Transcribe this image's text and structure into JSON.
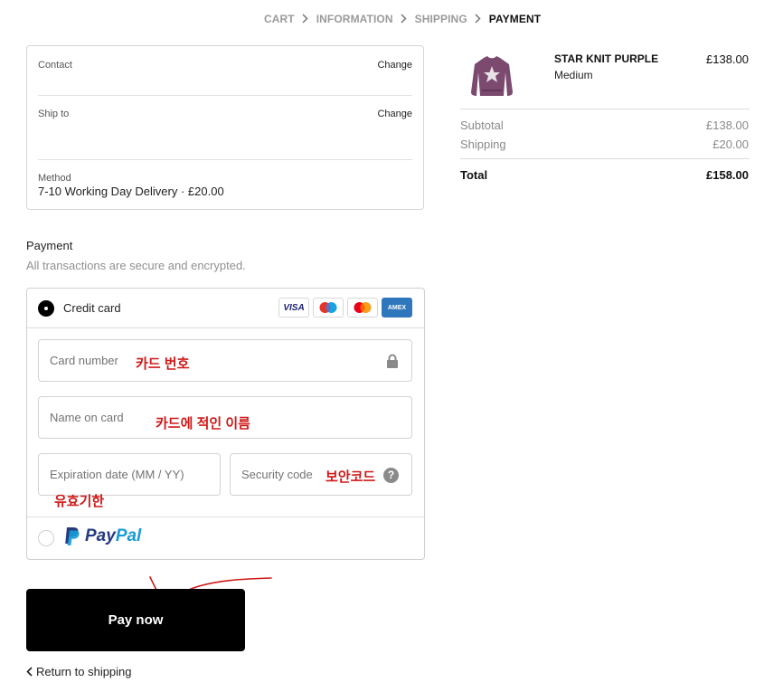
{
  "breadcrumb": {
    "items": [
      {
        "label": "CART",
        "active": false
      },
      {
        "label": "INFORMATION",
        "active": false
      },
      {
        "label": "SHIPPING",
        "active": false
      },
      {
        "label": "PAYMENT",
        "active": true
      }
    ],
    "separator_icon": "chevron-right-icon"
  },
  "review": {
    "contact": {
      "label": "Contact",
      "change": "Change",
      "value": ""
    },
    "ship_to": {
      "label": "Ship to",
      "change": "Change",
      "value": ""
    },
    "method": {
      "label": "Method",
      "value": "7-10 Working Day Delivery · £20.00"
    }
  },
  "payment": {
    "heading": "Payment",
    "subheading": "All transactions are secure and encrypted.",
    "credit_card": {
      "label": "Credit card",
      "selected": true,
      "brands": [
        "VISA",
        "Maestro",
        "Mastercard",
        "AMEX"
      ],
      "card_number_placeholder": "Card number",
      "card_number_annotation": "카드 번호",
      "name_placeholder": "Name on card",
      "name_annotation": "카드에 적인 이름",
      "expiry_placeholder": "Expiration date (MM / YY)",
      "expiry_annotation": "유효기한",
      "security_placeholder": "Security code",
      "security_annotation": "보안코드",
      "help_glyph": "?"
    },
    "paypal": {
      "selected": false,
      "logo_pay": "Pay",
      "logo_pal": "Pal"
    }
  },
  "actions": {
    "pay_now": "Pay now",
    "return": "Return to shipping"
  },
  "summary": {
    "product": {
      "name": "STAR KNIT PURPLE",
      "variant": "Medium",
      "price": "£138.00"
    },
    "subtotal_label": "Subtotal",
    "subtotal_value": "£138.00",
    "shipping_label": "Shipping",
    "shipping_value": "£20.00",
    "total_label": "Total",
    "total_value": "£158.00"
  },
  "colors": {
    "annotation": "#d01818",
    "button": "#000000",
    "paypal_dark": "#253b80",
    "paypal_light": "#179bd7",
    "amex": "#2e77bc",
    "product": "#7b4a6e"
  }
}
